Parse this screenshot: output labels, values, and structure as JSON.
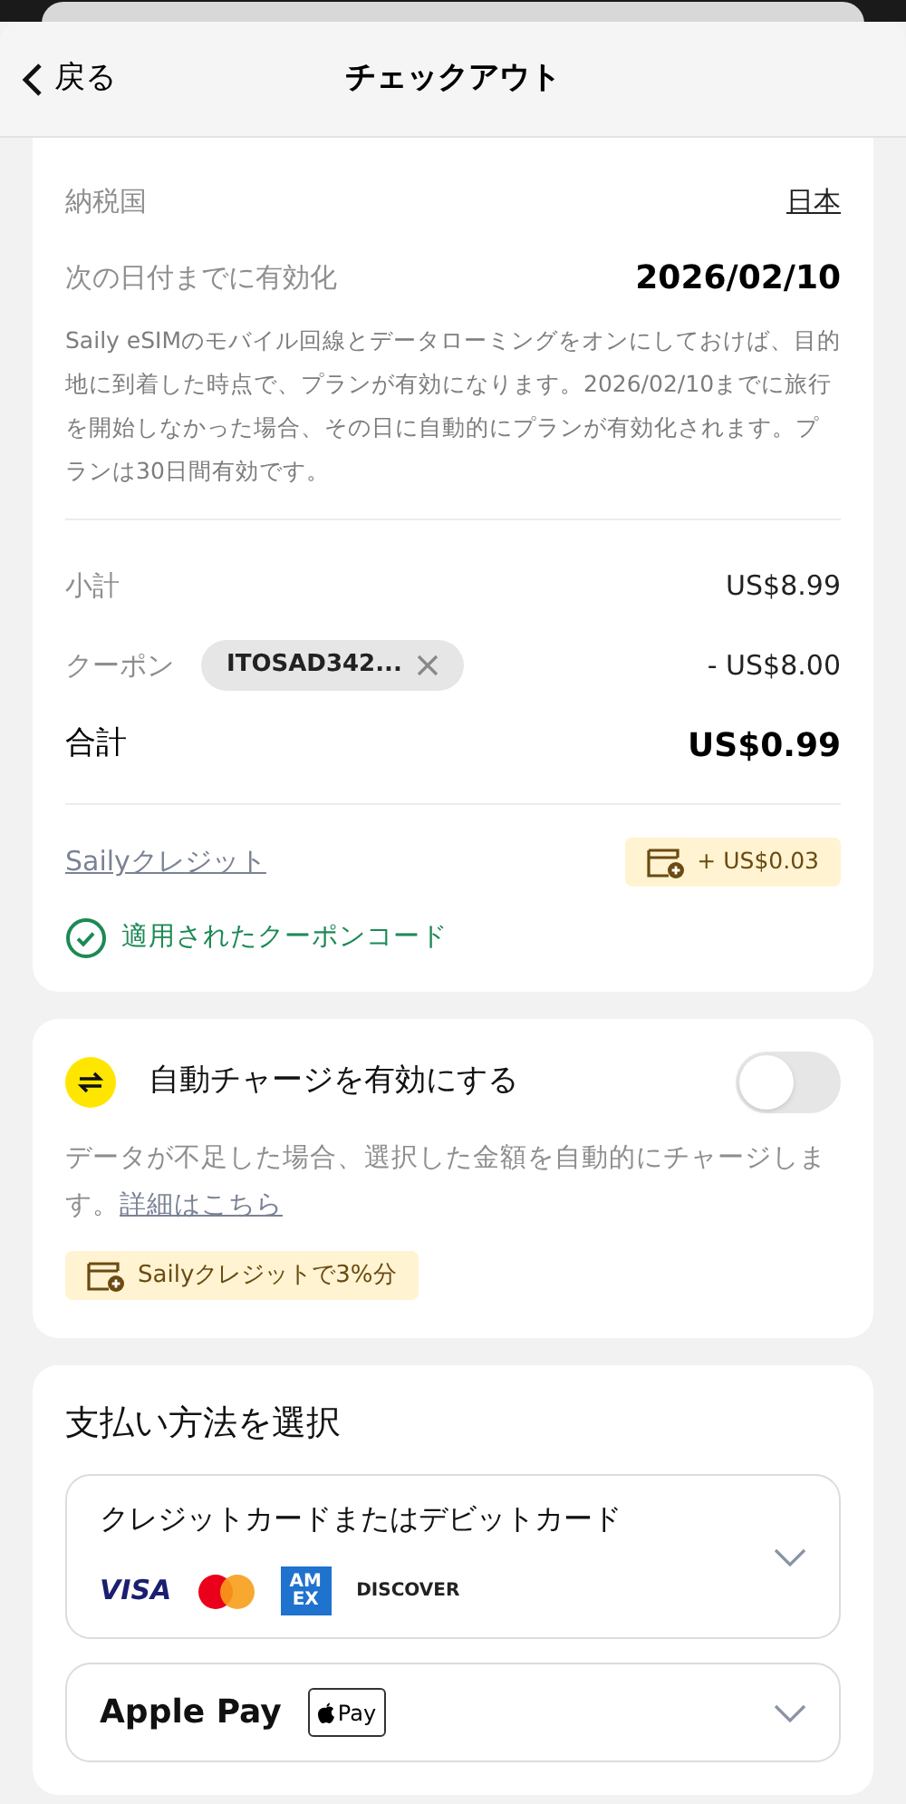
{
  "header": {
    "back": "戻る",
    "title": "チェックアウト"
  },
  "details": [
    {
      "label": "納税国",
      "value": "日本",
      "kind": "link"
    },
    {
      "label": "次の日付までに有効化",
      "value": "2026/02/10",
      "kind": "bold"
    }
  ],
  "note": "Saily eSIMのモバイル回線とデータローミングをオンにしておけば、目的地に到着した時点で、プランが有効になります。2026/02/10までに旅行を開始しなかった場合、その日に自動的にプランが有効化されます。プランは30日間有効です。",
  "summary": [
    {
      "label": "小計",
      "value": "US$8.99",
      "kind": "plain"
    },
    {
      "label": "クーポン",
      "value": "- US$8.00",
      "kind": "coupon",
      "code": "ITOSAD342..."
    },
    {
      "label": "合計",
      "value": "US$0.99",
      "kind": "total"
    }
  ],
  "credit": {
    "label": "Sailyクレジット",
    "badge": "+ US$0.03"
  },
  "coupon_status": "適用されたクーポンコード",
  "auto_charge": {
    "title": "自動チャージを有効にする",
    "on": false,
    "description": "データが不足した場合、選択した金額を自動的にチャージします。",
    "link": "詳細はこちら",
    "badge": "Sailyクレジットで3%分"
  },
  "payment": {
    "title": "支払い方法を選択",
    "methods": [
      {
        "kind": "card",
        "label": "クレジットカードまたはデビットカード",
        "logos": [
          "VISA",
          "AM",
          "EX",
          "DISCOVER"
        ]
      },
      {
        "kind": "applepay",
        "label": "Apple Pay",
        "mark": "Pay"
      }
    ]
  }
}
